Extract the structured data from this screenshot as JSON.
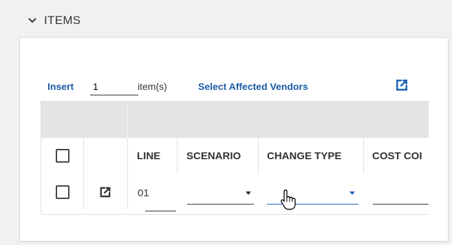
{
  "section": {
    "title": "ITEMS",
    "chevron_icon": "chevron-down-icon"
  },
  "toolbar": {
    "insert_label": "Insert",
    "quantity_value": "1",
    "items_label": "item(s)",
    "vendors_label": "Select Affected Vendors",
    "popout_icon": "open-in-new-icon"
  },
  "table": {
    "columns": [
      "",
      "",
      "LINE",
      "SCENARIO",
      "CHANGE TYPE",
      "COST COI"
    ],
    "rows": [
      {
        "line": "01",
        "scenario": "",
        "change_type": "",
        "cost_code": ""
      }
    ]
  },
  "colors": {
    "link": "#1a5aa6",
    "active_underline": "#1a63b4"
  }
}
